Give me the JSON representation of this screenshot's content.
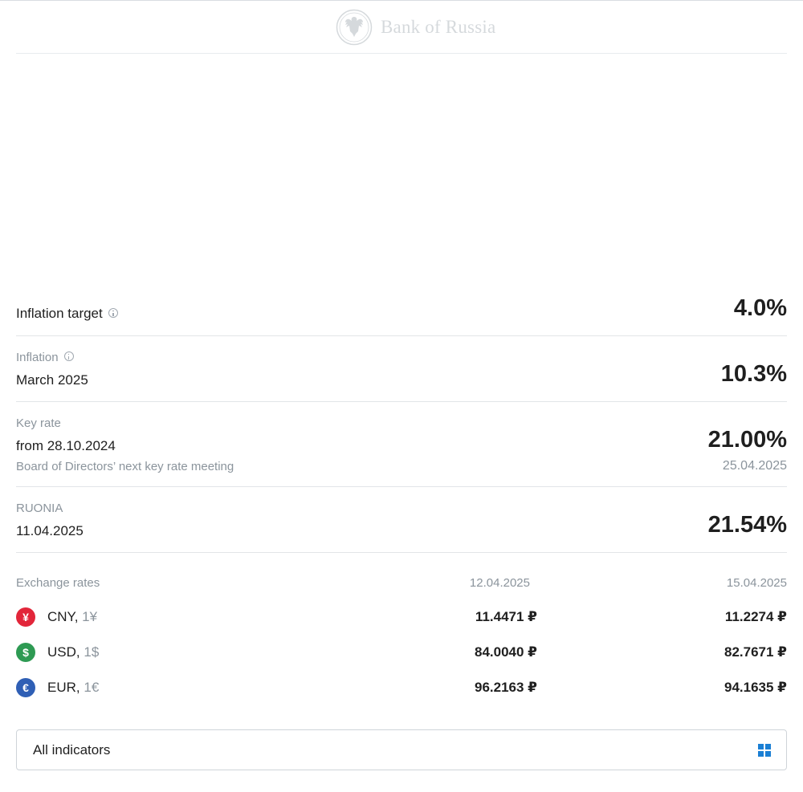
{
  "header": {
    "logo_text": "Bank of Russia",
    "logo_icon": "double-headed-eagle-emblem"
  },
  "indicators": {
    "inflation_target": {
      "label": "Inflation target",
      "value": "4.0%"
    },
    "inflation": {
      "label": "Inflation",
      "period": "March 2025",
      "value": "10.3%"
    },
    "key_rate": {
      "label": "Key rate",
      "period": "from 28.10.2024",
      "value": "21.00%",
      "next_meeting_label": "Board of Directors’ next key rate meeting",
      "next_meeting_date": "25.04.2025"
    },
    "ruonia": {
      "label": "RUONIA",
      "period": "11.04.2025",
      "value": "21.54%"
    }
  },
  "exchange_rates": {
    "label": "Exchange rates",
    "date1": "12.04.2025",
    "date2": "15.04.2025",
    "currencies": [
      {
        "code": "CNY,",
        "unit": "1¥",
        "symbol": "¥",
        "color": "#e2263a",
        "value1": "11.4471 ₽",
        "value2": "11.2274 ₽"
      },
      {
        "code": "USD,",
        "unit": "1$",
        "symbol": "$",
        "color": "#2e9a53",
        "value1": "84.0040 ₽",
        "value2": "82.7671 ₽"
      },
      {
        "code": "EUR,",
        "unit": "1€",
        "symbol": "€",
        "color": "#2f5fb5",
        "value1": "96.2163 ₽",
        "value2": "94.1635 ₽"
      }
    ]
  },
  "all_indicators": {
    "label": "All indicators",
    "icon": "grid-icon",
    "icon_color": "#1a7fd4"
  }
}
